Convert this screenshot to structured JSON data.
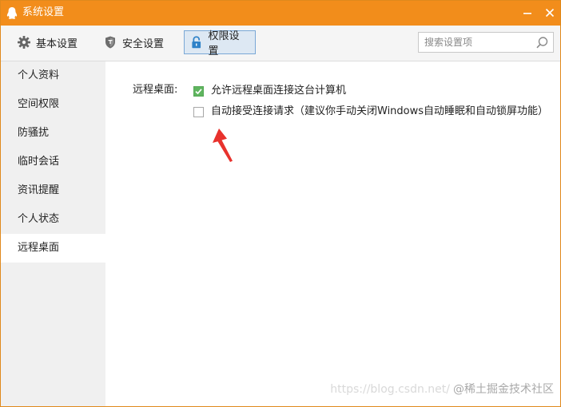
{
  "window": {
    "title": "系统设置",
    "accent_color": "#f28d1b",
    "controls": {
      "minimize_icon": "minimize-icon",
      "close_icon": "close-icon"
    }
  },
  "toolbar": {
    "tabs": [
      {
        "label": "基本设置",
        "icon": "gear-icon",
        "active": false
      },
      {
        "label": "安全设置",
        "icon": "shield-icon",
        "active": false
      },
      {
        "label": "权限设置",
        "icon": "lock-icon",
        "active": true
      }
    ],
    "search": {
      "placeholder": "搜索设置项",
      "value": "",
      "icon": "search-icon"
    }
  },
  "sidebar": {
    "items": [
      {
        "label": "个人资料",
        "active": false
      },
      {
        "label": "空间权限",
        "active": false
      },
      {
        "label": "防骚扰",
        "active": false
      },
      {
        "label": "临时会话",
        "active": false
      },
      {
        "label": "资讯提醒",
        "active": false
      },
      {
        "label": "个人状态",
        "active": false
      },
      {
        "label": "远程桌面",
        "active": true
      }
    ]
  },
  "content": {
    "section_label": "远程桌面:",
    "options": [
      {
        "label": "允许远程桌面连接这台计算机",
        "checked": true,
        "color": "#5fb55f"
      },
      {
        "label": "自动接受连接请求（建议你手动关闭Windows自动睡眠和自动锁屏功能）",
        "checked": false
      }
    ],
    "annotation_color": "#e8322d"
  },
  "watermark": {
    "url_text": "https://blog.csdn.net/",
    "main_text": "@稀土掘金技术社区"
  }
}
